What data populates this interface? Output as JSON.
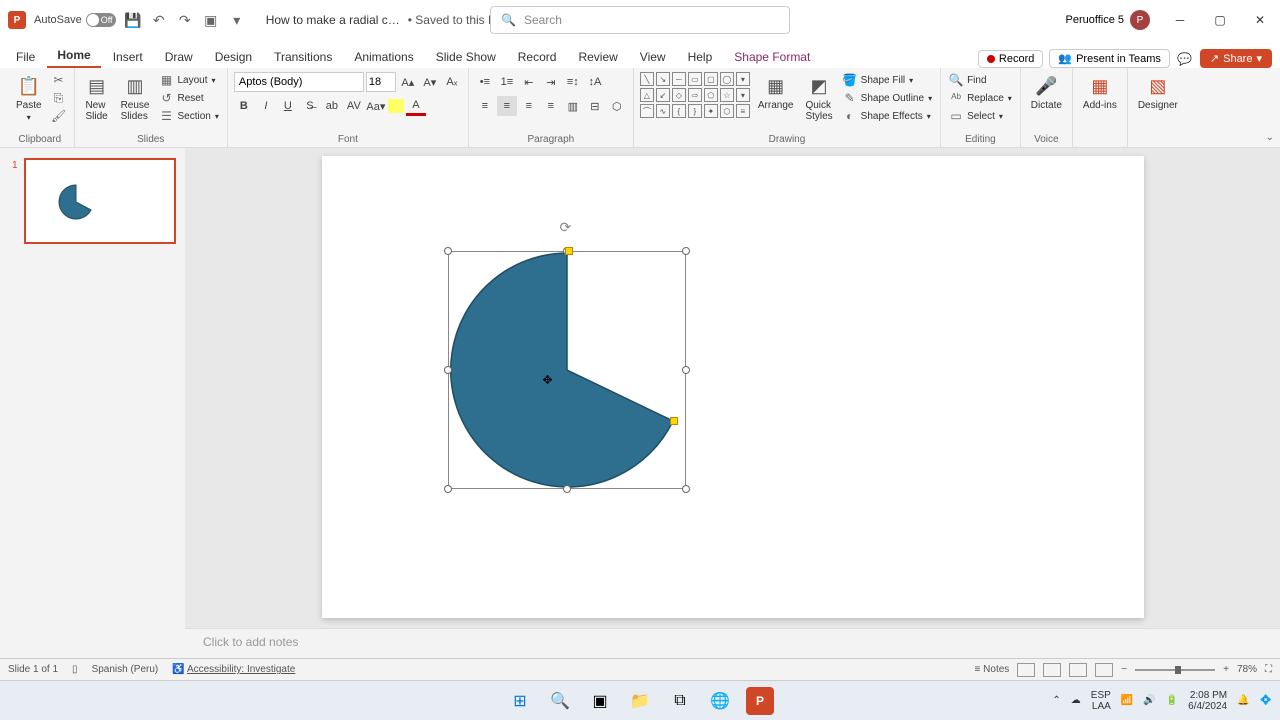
{
  "titlebar": {
    "autosave_label": "AutoSave",
    "autosave_state": "Off",
    "doc_name": "How to make a radial c…",
    "save_status": "• Saved to this PC",
    "search_placeholder": "Search",
    "user_name": "Peruoffice 5",
    "user_initial": "P"
  },
  "tabs": {
    "file": "File",
    "home": "Home",
    "insert": "Insert",
    "draw": "Draw",
    "design": "Design",
    "transitions": "Transitions",
    "animations": "Animations",
    "slideshow": "Slide Show",
    "record": "Record",
    "review": "Review",
    "view": "View",
    "help": "Help",
    "shape_format": "Shape Format",
    "record_btn": "Record",
    "present_teams": "Present in Teams",
    "share": "Share"
  },
  "ribbon": {
    "clipboard": {
      "label": "Clipboard",
      "paste": "Paste"
    },
    "slides": {
      "label": "Slides",
      "new_slide": "New\nSlide",
      "reuse": "Reuse\nSlides",
      "layout": "Layout",
      "reset": "Reset",
      "section": "Section"
    },
    "font": {
      "label": "Font",
      "name": "Aptos (Body)",
      "size": "18"
    },
    "paragraph": {
      "label": "Paragraph"
    },
    "drawing": {
      "label": "Drawing",
      "arrange": "Arrange",
      "quick_styles": "Quick\nStyles",
      "shape_fill": "Shape Fill",
      "shape_outline": "Shape Outline",
      "shape_effects": "Shape Effects"
    },
    "editing": {
      "label": "Editing",
      "find": "Find",
      "replace": "Replace",
      "select": "Select"
    },
    "voice": {
      "label": "Voice",
      "dictate": "Dictate"
    },
    "addins": {
      "label": "Add-ins",
      "btn": "Add-ins"
    },
    "designer": {
      "label": "Designer",
      "btn": "Designer"
    }
  },
  "thumbnails": {
    "slide1_num": "1"
  },
  "notes": {
    "placeholder": "Click to add notes"
  },
  "statusbar": {
    "slide_info": "Slide 1 of 1",
    "language": "Spanish (Peru)",
    "accessibility": "Accessibility: Investigate",
    "notes_btn": "Notes",
    "zoom_pct": "78%"
  },
  "systray": {
    "lang1": "ESP",
    "lang2": "LAA",
    "time": "2:08 PM",
    "date": "6/4/2024"
  },
  "colors": {
    "shape_fill": "#2e6e8e",
    "accent": "#d04727"
  }
}
